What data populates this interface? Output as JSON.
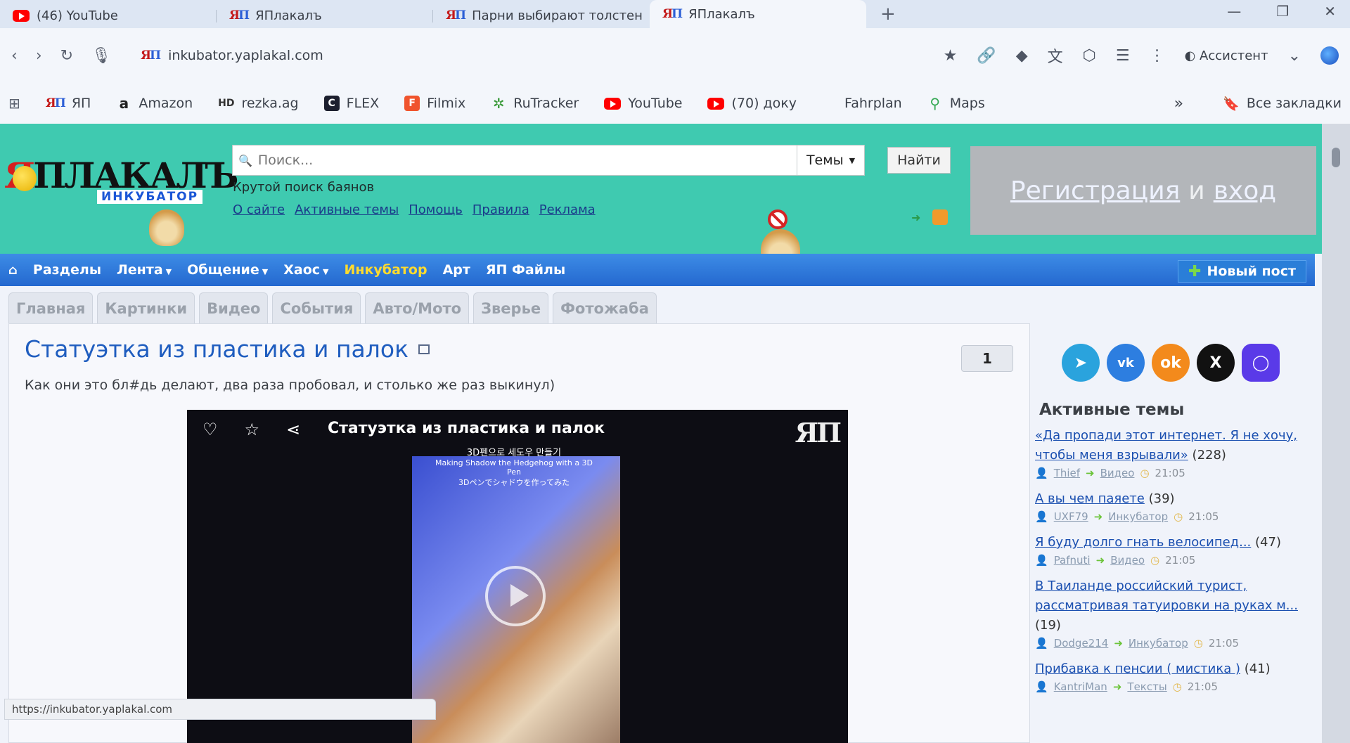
{
  "browser": {
    "tabs": [
      {
        "label": "(46) YouTube",
        "icon": "youtube-icon"
      },
      {
        "label": "ЯПлакалъ",
        "icon": "yaplakal-icon"
      },
      {
        "label": "Парни выбирают толстен",
        "icon": "yaplakal-icon"
      },
      {
        "label": "ЯПлакалъ",
        "icon": "yaplakal-icon",
        "active": true
      }
    ],
    "url": "inkubator.yaplakal.com",
    "assistant_label": "Ассистент",
    "bookmarks": [
      {
        "label": "ЯП",
        "icon": "yaplakal-icon"
      },
      {
        "label": "Amazon",
        "icon": "amazon-icon"
      },
      {
        "label": "rezka.ag",
        "icon": "hd-icon",
        "prefix": "HD"
      },
      {
        "label": "FLEX",
        "icon": "flex-icon",
        "prefix": "C"
      },
      {
        "label": "Filmix",
        "icon": "filmix-icon",
        "prefix": "F"
      },
      {
        "label": "RuTracker",
        "icon": "rutracker-icon"
      },
      {
        "label": "YouTube",
        "icon": "youtube-icon"
      },
      {
        "label": "(70) доку",
        "icon": "youtube-icon"
      },
      {
        "label": "Fahrplan",
        "icon": "microsoft-icon"
      },
      {
        "label": "Maps",
        "icon": "maps-pin-icon"
      }
    ],
    "all_bookmarks_label": "Все закладки",
    "more_glyph": "»"
  },
  "header": {
    "logo_text": "ЯПЛАКАЛЪ",
    "logo_sub": "ИНКУБАТОР",
    "search_placeholder": "Поиск...",
    "themes_label": "Темы",
    "find_label": "Найти",
    "search_hint": "Крутой поиск баянов",
    "links": [
      "О сайте",
      "Активные темы",
      "Помощь",
      "Правила",
      "Реклама"
    ],
    "register_label": "Регистрация",
    "and_label": "и",
    "login_label": "вход"
  },
  "nav": {
    "items": [
      {
        "label": "Разделы",
        "dropdown": false
      },
      {
        "label": "Лента",
        "dropdown": true
      },
      {
        "label": "Общение",
        "dropdown": true
      },
      {
        "label": "Хаос",
        "dropdown": true
      },
      {
        "label": "Инкубатор",
        "dropdown": false,
        "active": true
      },
      {
        "label": "Арт",
        "dropdown": false
      },
      {
        "label": "ЯП Файлы",
        "dropdown": false
      }
    ],
    "new_post_label": "Новый пост"
  },
  "subtabs": [
    "Главная",
    "Картинки",
    "Видео",
    "События",
    "Авто/Мото",
    "Зверье",
    "Фотожаба"
  ],
  "post": {
    "title": "Статуэтка из пластика и палок",
    "description": "Как они это бл#дь делают, два раза пробовал, и столько же раз выкинул)",
    "counter": "1",
    "video_title": "Статуэтка из пластика и палок",
    "video_logo": "ЯП",
    "video_sub_line1": "3D펜으로 세도우 만들기",
    "video_sub_line2": "Making Shadow the Hedgehog with a 3D Pen",
    "video_sub_line3": "3Dペンでシャドウを作ってみた"
  },
  "status_url": "https://inkubator.yaplakal.com",
  "sidebar": {
    "title": "Активные темы",
    "topics": [
      {
        "title": "«Да пропади этот интернет. Я не хочу, чтобы меня взрывали»",
        "count": "(228)",
        "user": "Thief",
        "section": "Видео",
        "time": "21:05"
      },
      {
        "title": "А вы чем паяете",
        "count": "(39)",
        "user": "UXF79",
        "section": "Инкубатор",
        "time": "21:05"
      },
      {
        "title": "Я буду долго гнать велосипед...",
        "count": "(47)",
        "user": "Pafnuti",
        "section": "Видео",
        "time": "21:05"
      },
      {
        "title": "В Таиланде российский турист, рассматривая татуировки на руках м...",
        "count": "(19)",
        "user": "Dodge214",
        "section": "Инкубатор",
        "time": "21:05"
      },
      {
        "title": "Прибавка к пенсии ( мистика )",
        "count": "(41)",
        "user": "KantriMan",
        "section": "Тексты",
        "time": "21:05"
      }
    ]
  },
  "colors": {
    "header_bg": "#3fcab0",
    "nav_bg": "#2468cf",
    "nav_active": "#ffdb2e",
    "link": "#1a4fb0",
    "title": "#1f5dbf"
  }
}
